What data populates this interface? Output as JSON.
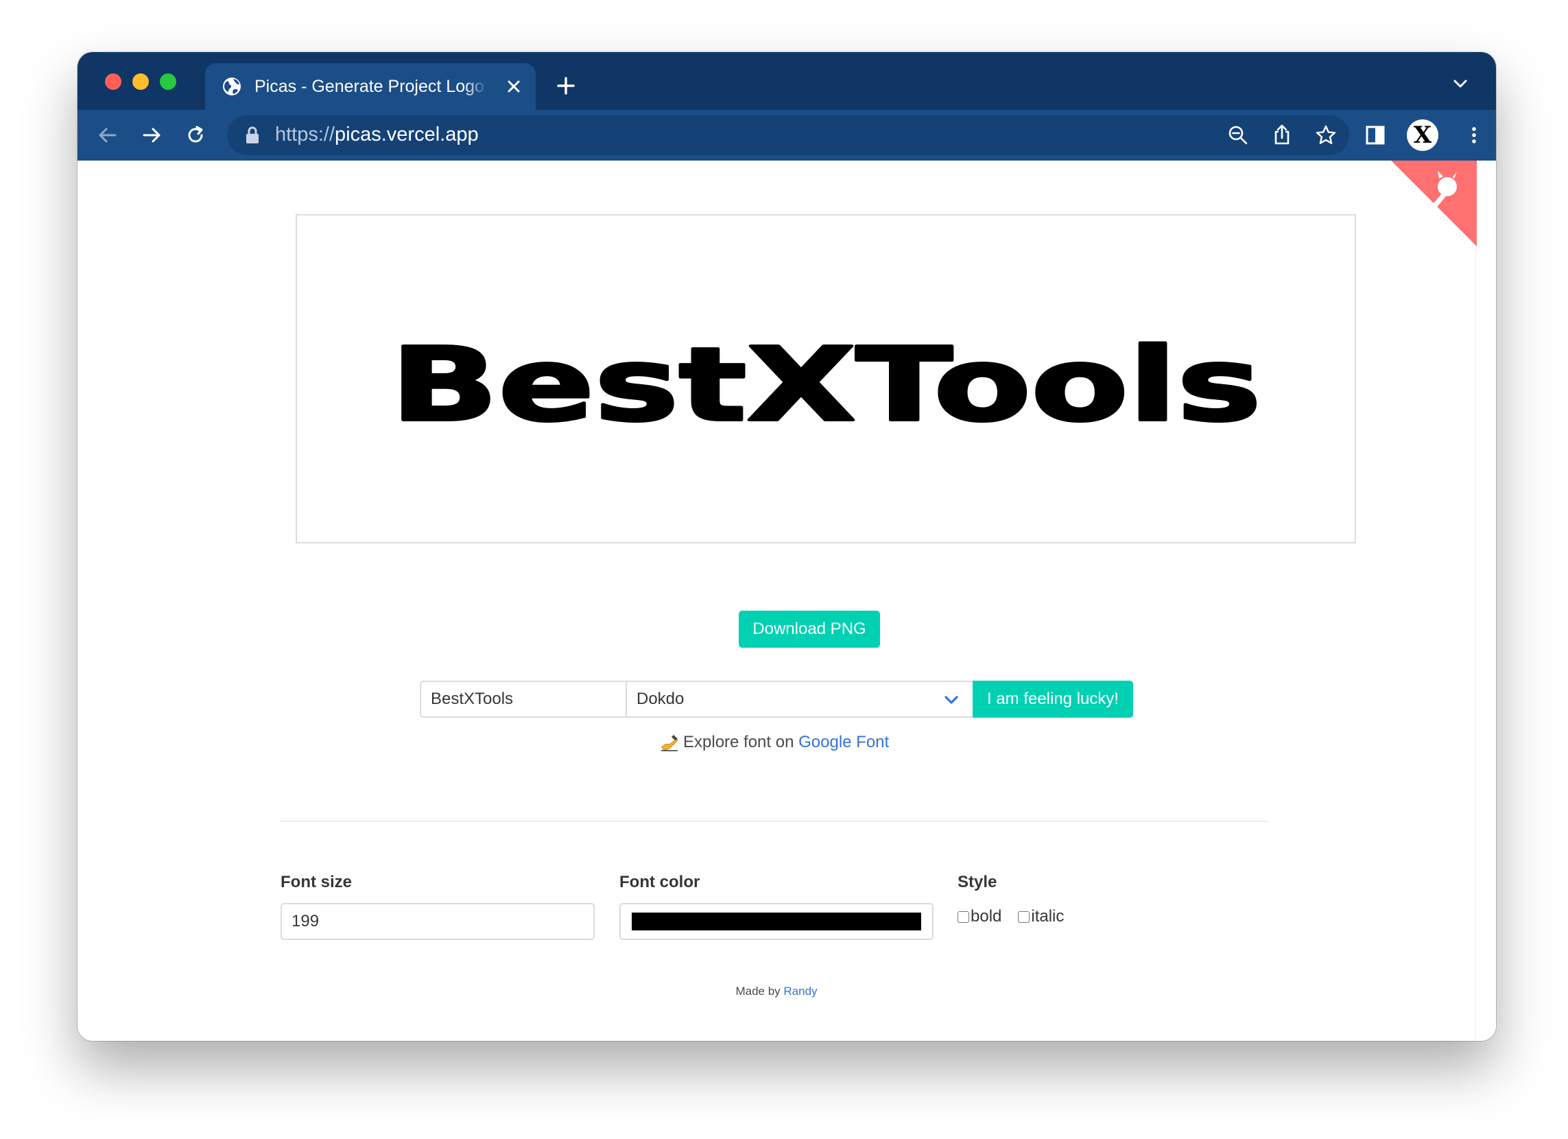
{
  "browser": {
    "tab_title": "Picas - Generate Project Logo with Text",
    "url_scheme": "https://",
    "url_host": "picas.vercel.app",
    "profile_letter": "X"
  },
  "preview": {
    "logo_text": "BestXTools",
    "text_color": "#000000"
  },
  "actions": {
    "download_label": "Download PNG",
    "lucky_label": "I am feeling lucky!"
  },
  "form": {
    "text_value": "BestXTools",
    "font_value": "Dokdo",
    "explore_prefix": "Explore font on",
    "explore_link": "Google Font"
  },
  "controls": {
    "size_label": "Font size",
    "size_value": "199",
    "color_label": "Font color",
    "color_value": "#000000",
    "style_label": "Style",
    "bold_label": "bold",
    "italic_label": "italic"
  },
  "footer": {
    "made_by": "Made by",
    "author": "Randy"
  },
  "colors": {
    "tabstrip": "#0f3665",
    "toolbar": "#1b4d87",
    "accent_teal": "#00d1b2",
    "link_blue": "#3273dc",
    "ribbon": "#ff7070"
  }
}
